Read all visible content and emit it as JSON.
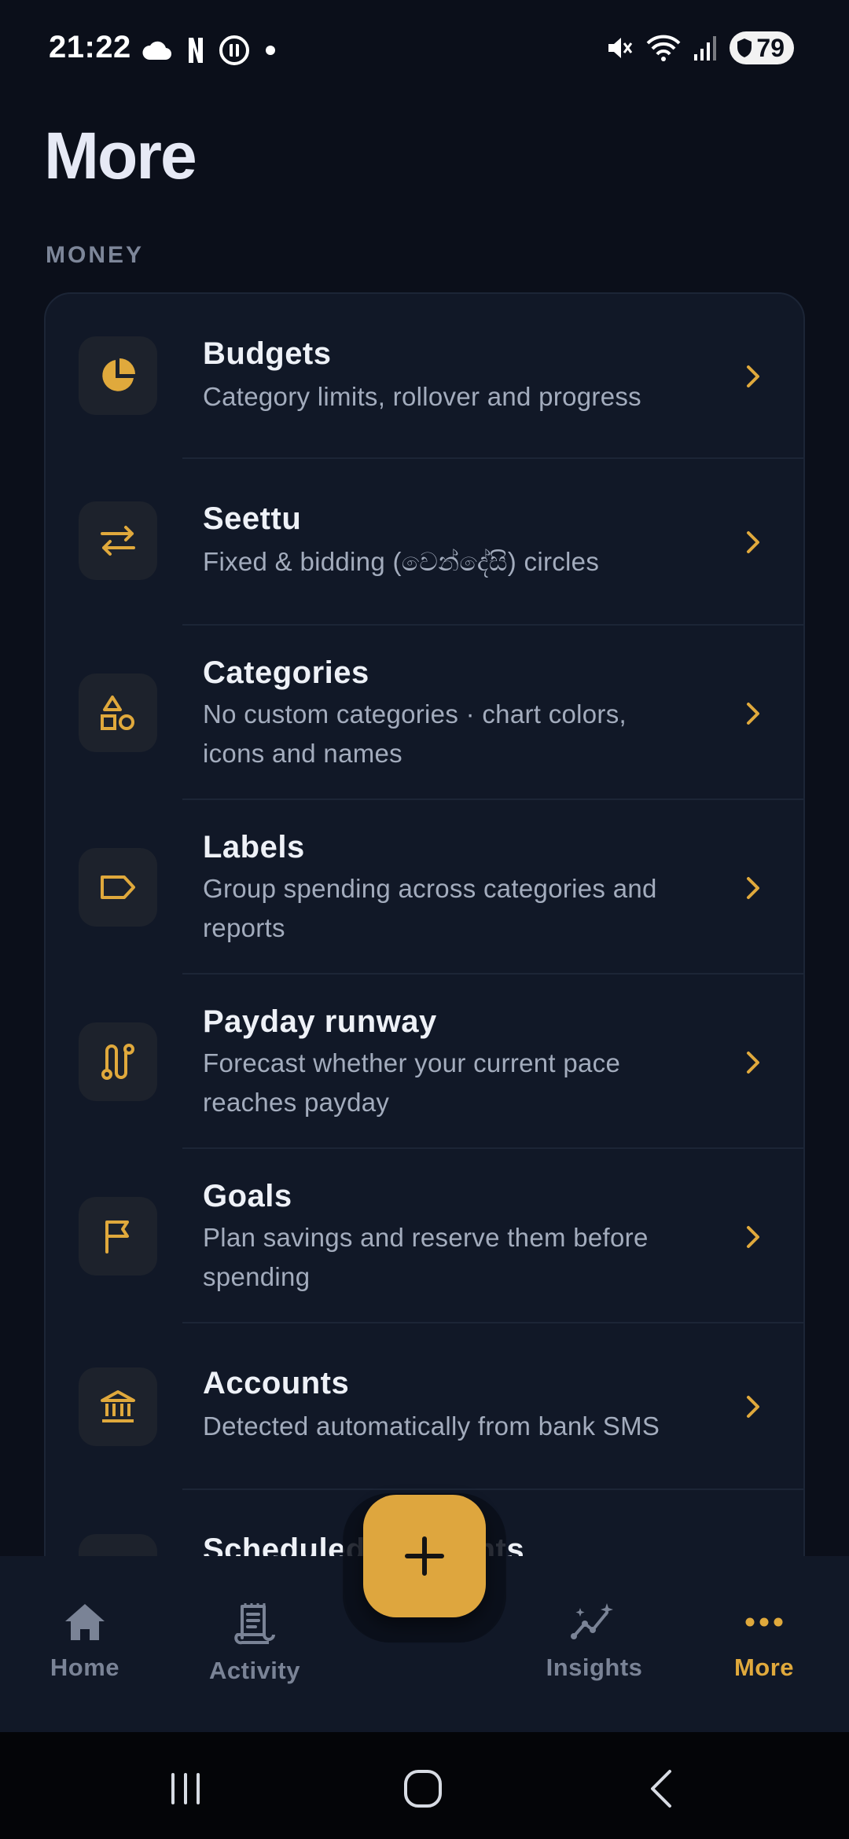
{
  "status_bar": {
    "time": "21:22",
    "left_icons": [
      "cloud-icon",
      "netflix-icon",
      "pause-icon",
      "dot-icon"
    ],
    "right_icons": [
      "mute-icon",
      "wifi-icon",
      "signal-icon"
    ],
    "battery": "79"
  },
  "page": {
    "title": "More"
  },
  "section": {
    "label": "MONEY"
  },
  "items": [
    {
      "title": "Budgets",
      "subtitle": "Category limits, rollover and progress",
      "icon": "pie-chart-icon"
    },
    {
      "title": "Seettu",
      "subtitle": "Fixed & bidding (වෙන්දේසි) circles",
      "icon": "swap-arrows-icon"
    },
    {
      "title": "Categories",
      "subtitle_lines": [
        "No custom categories · chart colors,",
        "icons and names"
      ],
      "icon": "shapes-icon"
    },
    {
      "title": "Labels",
      "subtitle_lines": [
        "Group spending across categories and",
        "reports"
      ],
      "icon": "tag-icon"
    },
    {
      "title": "Payday runway",
      "subtitle_lines": [
        "Forecast whether your current pace",
        "reaches payday"
      ],
      "icon": "route-icon"
    },
    {
      "title": "Goals",
      "subtitle_lines": [
        "Plan savings and reserve them before",
        "spending"
      ],
      "icon": "flag-icon"
    },
    {
      "title": "Accounts",
      "subtitle": "Detected automatically from bank SMS",
      "icon": "bank-icon"
    },
    {
      "title": "Scheduled payments",
      "icon": "calendar-icon"
    }
  ],
  "bottom_nav": {
    "home": "Home",
    "activity": "Activity",
    "insights": "Insights",
    "more": "More",
    "active": "More"
  },
  "fab": {
    "icon": "plus-icon"
  },
  "colors": {
    "background": "#0b0f1a",
    "card": "#111827",
    "accent": "#e0a93c",
    "fab": "#dea63e",
    "muted_text": "#a3acbd",
    "inactive_nav": "#7a8396"
  }
}
